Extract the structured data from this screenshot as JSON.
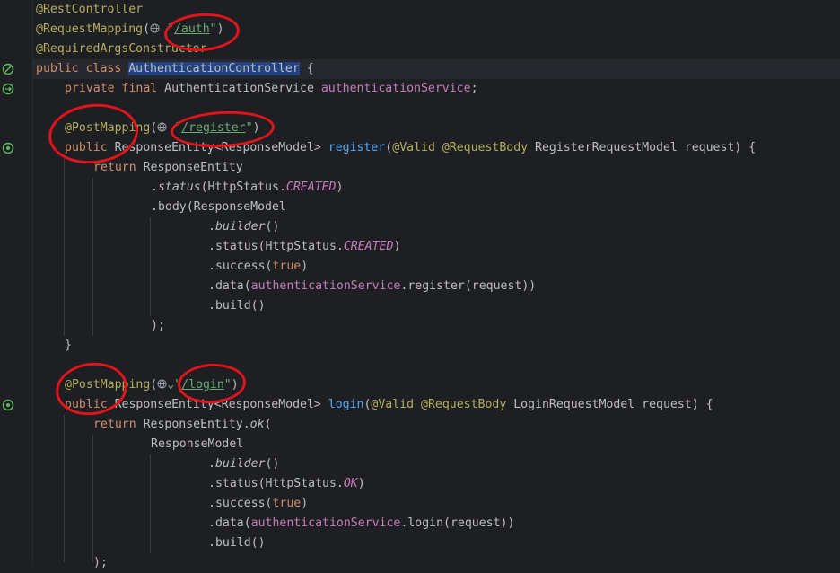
{
  "code": {
    "l1": "@RestController",
    "l2_ann": "@RequestMapping",
    "l2_open": "(",
    "l2_q1": "\"",
    "l2_url": "/auth",
    "l2_q2": "\"",
    "l2_close": ")",
    "l3": "@RequiredArgsConstructor",
    "l4_kw": "public class ",
    "l4_name": "AuthenticationController",
    "l4_rest": " {",
    "l5_kw": "private final ",
    "l5_type": "AuthenticationService ",
    "l5_field": "authenticationService",
    "l5_end": ";",
    "l7_ann": "@PostMapping",
    "l7_open": "(",
    "l7_q1": "\"",
    "l7_url": "/register",
    "l7_q2": "\"",
    "l7_close": ")",
    "l8_kw": "public ",
    "l8_type": "ResponseEntity<ResponseModel> ",
    "l8_fn": "register",
    "l8_p1": "(",
    "l8_a1": "@Valid ",
    "l8_a2": "@RequestBody ",
    "l8_rest": "RegisterRequestModel request) {",
    "l9_kw": "return ",
    "l9_rest": "ResponseEntity",
    "l10_dot": ".",
    "l10_m": "status",
    "l10_p": "(HttpStatus.",
    "l10_c": "CREATED",
    "l10_e": ")",
    "l11": ".body(ResponseModel",
    "l12_dot": ".",
    "l12_m": "builder",
    "l12_e": "()",
    "l13_p": ".status(HttpStatus.",
    "l13_c": "CREATED",
    "l13_e": ")",
    "l14_p": ".success(",
    "l14_kw": "true",
    "l14_e": ")",
    "l15_p": ".data(",
    "l15_f": "authenticationService",
    "l15_e": ".register(request))",
    "l16": ".build()",
    "l17": ");",
    "l18": "}",
    "l20_ann": "@PostMapping",
    "l20_open": "(",
    "l20_q1": "\"",
    "l20_url": "/login",
    "l20_q2": "\"",
    "l20_close": ")",
    "l21_kw": "public ",
    "l21_type": "ResponseEntity<ResponseModel> ",
    "l21_fn": "login",
    "l21_p1": "(",
    "l21_a1": "@Valid ",
    "l21_a2": "@RequestBody ",
    "l21_rest": "LoginRequestModel request) {",
    "l22_kw": "return ",
    "l22_rest": "ResponseEntity.",
    "l22_m": "ok",
    "l22_e": "(",
    "l23": "ResponseModel",
    "l24_dot": ".",
    "l24_m": "builder",
    "l24_e": "()",
    "l25_p": ".status(HttpStatus.",
    "l25_c": "OK",
    "l25_e": ")",
    "l26_p": ".success(",
    "l26_kw": "true",
    "l26_e": ")",
    "l27_p": ".data(",
    "l27_f": "authenticationService",
    "l27_e": ".login(request))",
    "l28": ".build()",
    "l29": ");"
  },
  "colors": {
    "background": "#1e1f22",
    "annotation": "#b3ae60",
    "keyword": "#cf8e6d",
    "field": "#c77dbb",
    "method": "#56a8f5",
    "string": "#6aab73",
    "selection": "#214283",
    "marker": "#e0141b"
  },
  "gutter_icons": [
    "spring-bean-icon",
    "spring-bean-icon",
    "endpoint-icon",
    "endpoint-icon"
  ]
}
